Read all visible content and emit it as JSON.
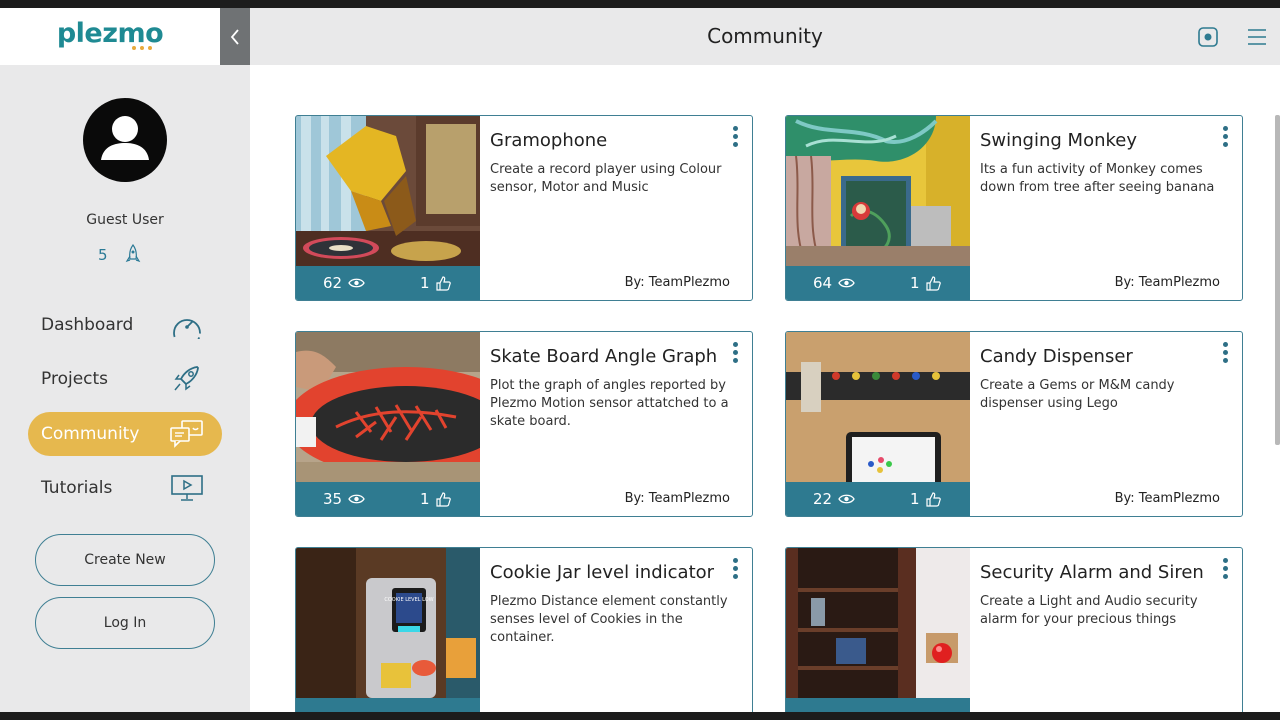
{
  "app": {
    "logo_text": "plezmo"
  },
  "header": {
    "title": "Community"
  },
  "sidebar": {
    "user_name": "Guest User",
    "points": "5",
    "nav": [
      {
        "label": "Dashboard",
        "icon": "speedometer-icon"
      },
      {
        "label": "Projects",
        "icon": "rocket-icon"
      },
      {
        "label": "Community",
        "icon": "chat-bubbles-icon",
        "active": true
      },
      {
        "label": "Tutorials",
        "icon": "presentation-icon"
      }
    ],
    "create_button": "Create New",
    "login_button": "Log In"
  },
  "colors": {
    "accent": "#e6b84e",
    "brand": "#1f8a93",
    "card_stats": "#2e7a90",
    "border": "#3f7f93"
  },
  "cards": [
    {
      "title": "Gramophone",
      "description": "Create a record player using Colour sensor, Motor and Music",
      "views": "62",
      "likes": "1",
      "author": "By: TeamPlezmo"
    },
    {
      "title": "Swinging Monkey",
      "description": "Its a fun activity of Monkey comes down from tree after seeing banana",
      "views": "64",
      "likes": "1",
      "author": "By: TeamPlezmo"
    },
    {
      "title": "Skate Board Angle Graph",
      "description": "Plot the graph of angles reported by Plezmo Motion sensor attatched to a skate board.",
      "views": "35",
      "likes": "1",
      "author": "By: TeamPlezmo"
    },
    {
      "title": "Candy Dispenser",
      "description": "Create a Gems or M&M candy dispenser using Lego",
      "views": "22",
      "likes": "1",
      "author": "By: TeamPlezmo"
    },
    {
      "title": "Cookie Jar level indicator",
      "description": "Plezmo Distance element constantly senses level of Cookies in the container.",
      "views": "",
      "likes": "",
      "author": ""
    },
    {
      "title": "Security Alarm and Siren",
      "description": "Create a Light and Audio security alarm for your precious things",
      "views": "",
      "likes": "",
      "author": ""
    }
  ],
  "image_labels": {
    "cookie_screen": "COOKIE LEVEL LOW"
  }
}
